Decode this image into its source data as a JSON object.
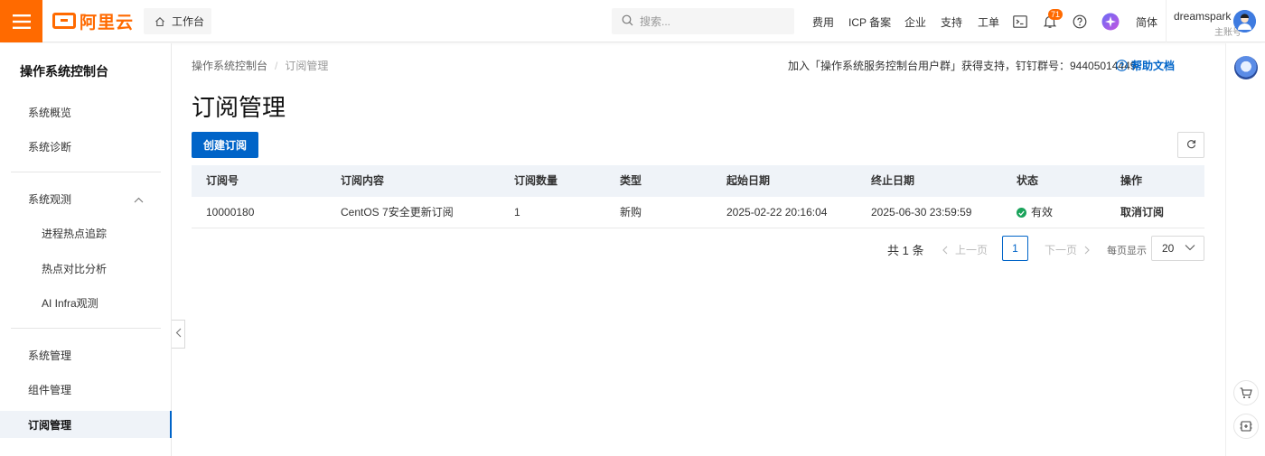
{
  "topbar": {
    "logo_text": "阿里云",
    "workbench": "工作台",
    "search_placeholder": "搜索...",
    "nav": [
      "费用",
      "ICP 备案",
      "企业",
      "支持",
      "工单"
    ],
    "notification_count": "71",
    "language": "简体",
    "user_name": "dreamspark",
    "user_role": "主账号"
  },
  "sidebar": {
    "title": "操作系统控制台",
    "items": [
      {
        "label": "系统概览",
        "level": 1
      },
      {
        "label": "系统诊断",
        "level": 1
      },
      {
        "label": "系统观测",
        "level": 1,
        "expanded": true
      },
      {
        "label": "进程热点追踪",
        "level": 2
      },
      {
        "label": "热点对比分析",
        "level": 2
      },
      {
        "label": "AI Infra观测",
        "level": 2
      },
      {
        "label": "系统管理",
        "level": 1
      },
      {
        "label": "组件管理",
        "level": 1
      },
      {
        "label": "订阅管理",
        "level": 1,
        "active": true
      }
    ]
  },
  "breadcrumb": [
    "操作系统控制台",
    "订阅管理"
  ],
  "notice": "加入「操作系统服务控制台用户群」获得支持，钉钉群号：94405014449",
  "help_link": "帮助文档",
  "page_title": "订阅管理",
  "create_button": "创建订阅",
  "table": {
    "headers": [
      "订阅号",
      "订阅内容",
      "订阅数量",
      "类型",
      "起始日期",
      "终止日期",
      "状态",
      "操作"
    ],
    "rows": [
      {
        "id": "10000180",
        "content": "CentOS 7安全更新订阅",
        "quantity": "1",
        "type": "新购",
        "start": "2025-02-22 20:16:04",
        "end": "2025-06-30 23:59:59",
        "status": "有效",
        "action": "取消订阅"
      }
    ]
  },
  "pagination": {
    "total": "共 1 条",
    "prev": "上一页",
    "page": "1",
    "next": "下一页",
    "page_size_label": "每页显示",
    "page_size": "20"
  },
  "colors": {
    "brand": "#ff6a00",
    "primary": "#0064c8",
    "success": "#1aa35b"
  }
}
